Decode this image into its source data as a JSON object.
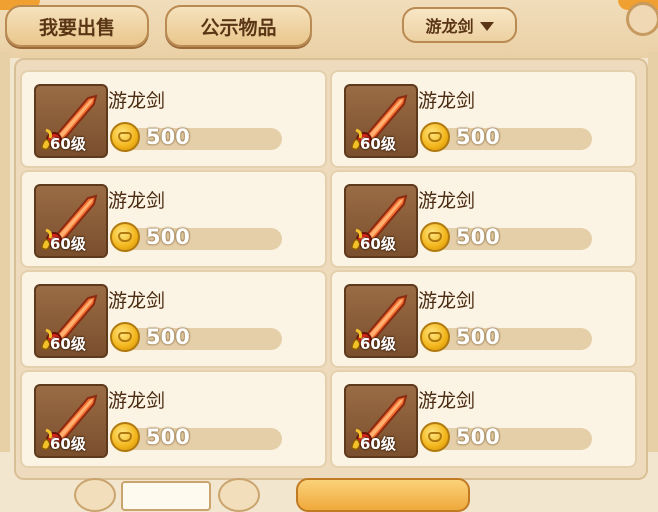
{
  "tabs": [
    {
      "label": "我要出售"
    },
    {
      "label": "公示物品"
    }
  ],
  "filter": {
    "selected": "游龙剑"
  },
  "items": [
    {
      "name": "游龙剑",
      "level": "60级",
      "price": "500"
    },
    {
      "name": "游龙剑",
      "level": "60级",
      "price": "500"
    },
    {
      "name": "游龙剑",
      "level": "60级",
      "price": "500"
    },
    {
      "name": "游龙剑",
      "level": "60级",
      "price": "500"
    },
    {
      "name": "游龙剑",
      "level": "60级",
      "price": "500"
    },
    {
      "name": "游龙剑",
      "level": "60级",
      "price": "500"
    },
    {
      "name": "游龙剑",
      "level": "60级",
      "price": "500"
    },
    {
      "name": "游龙剑",
      "level": "60级",
      "price": "500"
    }
  ],
  "icons": {
    "item": "sword-icon",
    "currency": "gold-coin-icon",
    "filter_caret": "caret-down-icon"
  },
  "colors": {
    "background": "#f3e6cf",
    "card": "#fbf3e3",
    "text": "#4a2a10",
    "coin": "#f2b419"
  }
}
